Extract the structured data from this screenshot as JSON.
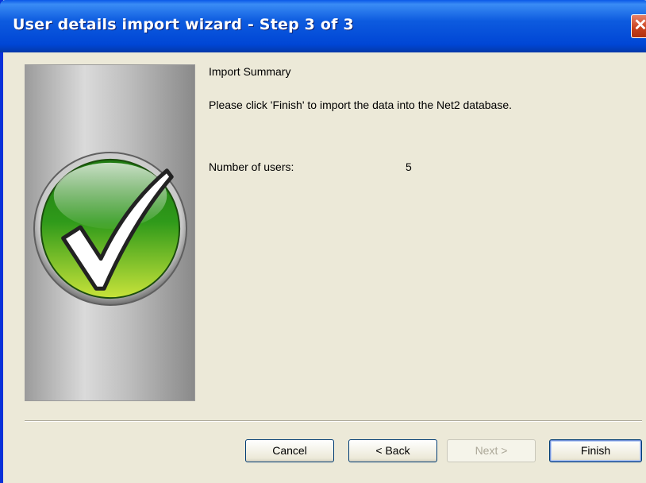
{
  "window": {
    "title": "User details import wizard - Step 3 of 3",
    "close_glyph": "✕"
  },
  "content": {
    "summary_title": "Import Summary",
    "instruction": "Please click 'Finish' to import the data into the Net2 database.",
    "users_label": "Number of users:",
    "users_value": "5"
  },
  "side_panel": {
    "icon": "green-checkmark-icon"
  },
  "buttons": {
    "cancel": "Cancel",
    "back": "< Back",
    "next": "Next >",
    "finish": "Finish"
  },
  "colors": {
    "titlebar": "#0a58e8",
    "close_button": "#c8401c",
    "dialog_background": "#ece9d8",
    "check_green": "#5aa82a"
  }
}
